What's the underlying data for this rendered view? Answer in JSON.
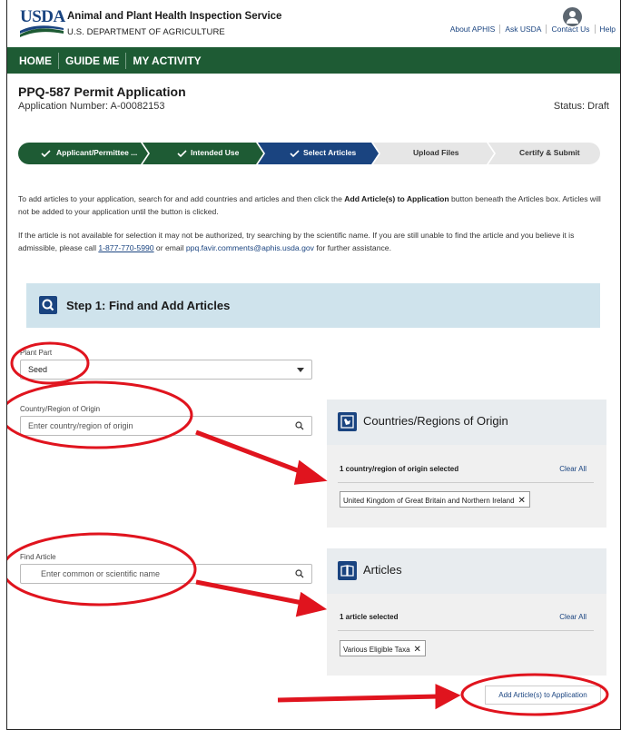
{
  "header": {
    "logo_text": "USDA",
    "agency": "Animal and Plant Health Inspection Service",
    "department": "U.S. DEPARTMENT OF AGRICULTURE",
    "links": [
      "About APHIS",
      "Ask USDA",
      "Contact Us",
      "Help"
    ],
    "user_icon": "user-avatar-icon"
  },
  "nav": {
    "items": [
      "HOME",
      "GUIDE ME",
      "MY ACTIVITY"
    ]
  },
  "application": {
    "title": "PPQ-587 Permit Application",
    "number": "Application Number: A-00082153",
    "status": "Status: Draft"
  },
  "stepper": {
    "colors": {
      "done": "#1e5b34",
      "current": "#1a4480",
      "pending": "#e6e6e6"
    },
    "steps": [
      {
        "label": "Applicant/Permittee ...",
        "state": "done",
        "icon": "check-icon"
      },
      {
        "label": "Intended Use",
        "state": "done",
        "icon": "check-icon"
      },
      {
        "label": "Select Articles",
        "state": "current",
        "icon": "check-icon"
      },
      {
        "label": "Upload Files",
        "state": "pending"
      },
      {
        "label": "Certify & Submit",
        "state": "pending"
      }
    ]
  },
  "instructions": {
    "p1_start": "To add articles to your application, search for and add countries and articles and then click the ",
    "p1_bold": "Add Article(s) to Application",
    "p1_end": " button beneath the Articles box. Articles will not be added to your application until the button is clicked.",
    "p2_start": "If the article is not available for selection it may not be authorized, try searching by the scientific name. If you are still unable to find the article and you believe it is admissible, please call ",
    "phone": "1-877-770-5990",
    "p2_mid": " or email ",
    "email": "ppq.favir.comments@aphis.usda.gov",
    "p2_end": " for further assistance."
  },
  "step1": {
    "title": "Step 1: Find and Add Articles",
    "icon": "search-icon"
  },
  "plant_part": {
    "label": "Plant Part",
    "value": "Seed"
  },
  "country_search": {
    "label": "Country/Region of Origin",
    "placeholder": "Enter country/region of origin"
  },
  "article_search": {
    "label": "Find Article",
    "placeholder": "Enter common or scientific name"
  },
  "countries_panel": {
    "title": "Countries/Regions of Origin",
    "icon": "map-icon",
    "count_text": "1 country/region of origin selected",
    "clear_label": "Clear All",
    "chips": [
      "United Kingdom of Great Britain and Northern Ireland"
    ]
  },
  "articles_panel": {
    "title": "Articles",
    "icon": "book-icon",
    "count_text": "1 article selected",
    "clear_label": "Clear All",
    "chips": [
      "Various Eligible Taxa"
    ]
  },
  "add_button": "Add Article(s) to Application",
  "annotation_color": "#e0141e"
}
